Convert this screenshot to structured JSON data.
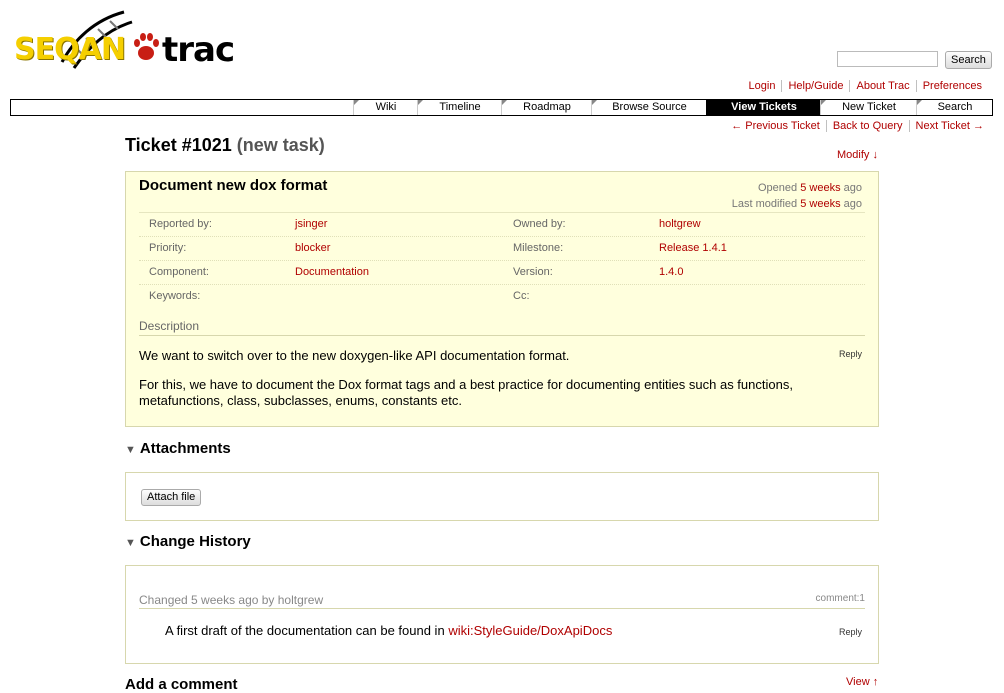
{
  "logo": {
    "seqan": "SEQAN",
    "trac": "trac"
  },
  "search": {
    "placeholder": "",
    "button": "Search"
  },
  "metanav": [
    "Login",
    "Help/Guide",
    "About Trac",
    "Preferences"
  ],
  "mainnav": [
    "Wiki",
    "Timeline",
    "Roadmap",
    "Browse Source",
    "View Tickets",
    "New Ticket",
    "Search"
  ],
  "ctxnav": [
    "← Previous Ticket",
    "Back to Query",
    "Next Ticket →"
  ],
  "ticket": {
    "number": "Ticket #1021",
    "status": "(new task)",
    "modify": "Modify ↓",
    "summary": "Document new dox format",
    "opened_prefix": "Opened",
    "opened": "5 weeks",
    "opened_suffix": "ago",
    "modified_prefix": "Last modified",
    "modified": "5 weeks",
    "modified_suffix": "ago",
    "props": {
      "reported_by_label": "Reported by:",
      "reported_by": "jsinger",
      "owned_by_label": "Owned by:",
      "owned_by": "holtgrew",
      "priority_label": "Priority:",
      "priority": "blocker",
      "milestone_label": "Milestone:",
      "milestone": "Release 1.4.1",
      "component_label": "Component:",
      "component": "Documentation",
      "version_label": "Version:",
      "version": "1.4.0",
      "keywords_label": "Keywords:",
      "keywords": "",
      "cc_label": "Cc:",
      "cc": ""
    },
    "description_label": "Description",
    "description_p1": "We want to switch over to the new doxygen-like API documentation format.",
    "description_p2": "For this, we have to document the Dox format tags and a best practice for documenting entities such as functions, metafunctions, class, subclasses, enums, constants etc.",
    "reply": "Reply"
  },
  "attachments": {
    "heading": "Attachments",
    "button": "Attach file"
  },
  "history": {
    "heading": "Change History",
    "changed": "Changed 5 weeks ago by holtgrew",
    "comment_num": "comment:1",
    "comment_prefix": "A first draft of the documentation can be found in",
    "comment_link": "wiki:StyleGuide/DoxApiDocs",
    "reply": "Reply"
  },
  "add_comment": {
    "heading": "Add a comment",
    "view": "View ↑"
  }
}
